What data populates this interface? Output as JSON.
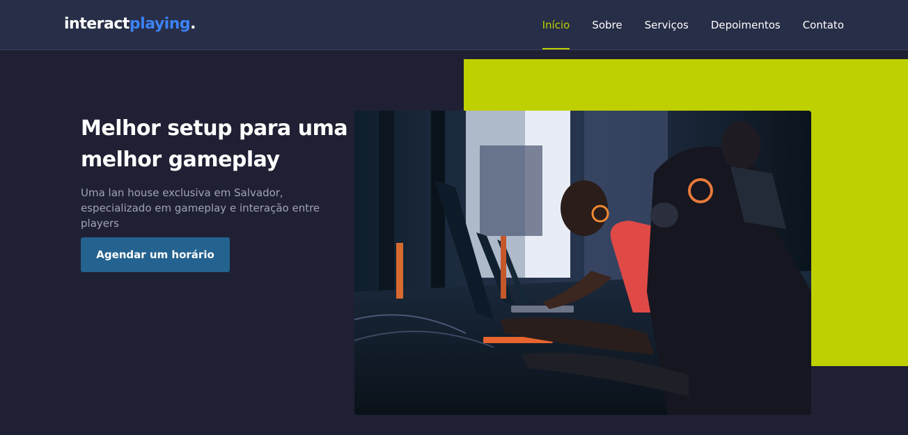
{
  "header": {
    "logo": {
      "part1": "interact",
      "part2": "playing",
      "dot": "."
    },
    "nav": [
      {
        "label": "Início",
        "active": true
      },
      {
        "label": "Sobre",
        "active": false
      },
      {
        "label": "Serviços",
        "active": false
      },
      {
        "label": "Depoimentos",
        "active": false
      },
      {
        "label": "Contato",
        "active": false
      }
    ]
  },
  "hero": {
    "title": "Melhor setup para uma melhor gameplay",
    "subtitle": "Uma lan house exclusiva em Salvador, especializado em gameplay e interação entre players",
    "cta_label": "Agendar um horário"
  },
  "colors": {
    "background": "#1f2033",
    "header": "#272e47",
    "accent": "#bed000",
    "brand_blue": "#3b82f6",
    "button": "#24628f"
  }
}
